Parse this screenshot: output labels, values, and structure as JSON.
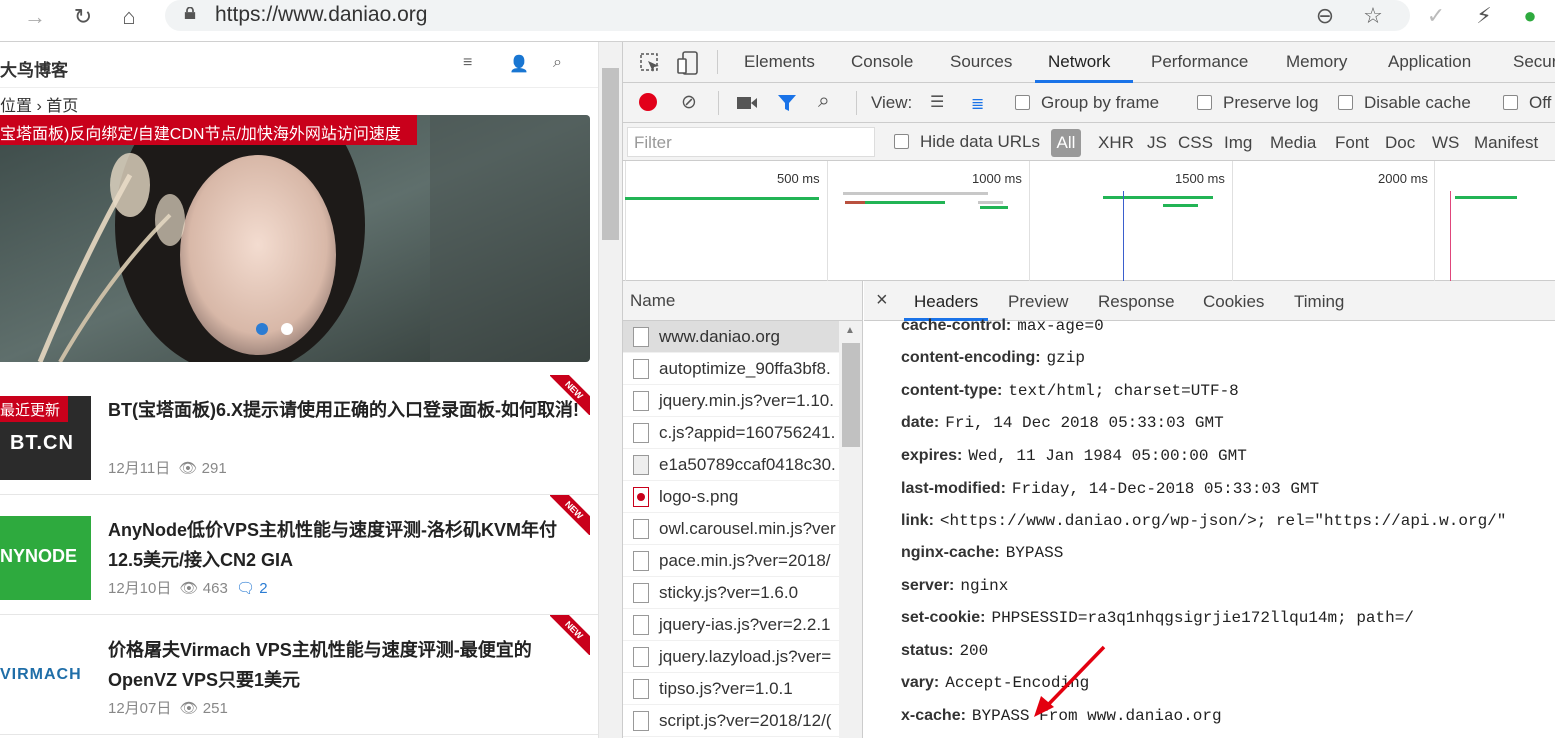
{
  "browser": {
    "url": "https://www.daniao.org"
  },
  "page": {
    "site_title": "大鸟博客",
    "breadcrumb": "位置 › 首页",
    "slider_caption": "宝塔面板)反向绑定/自建CDN节点/加快海外网站访问速度",
    "latest_badge": "最近更新",
    "new_ribbon": "NEW",
    "posts": [
      {
        "title": "BT(宝塔面板)6.X提示请使用正确的入口登录面板-如何取消!",
        "date": "12月11日",
        "views": "291",
        "comments": "",
        "thumb_label": "BT.CN",
        "thumb_color": "#2b2b2b"
      },
      {
        "title": "AnyNode低价VPS主机性能与速度评测-洛杉矶KVM年付12.5美元/接入CN2 GIA",
        "date": "12月10日",
        "views": "463",
        "comments": "2",
        "thumb_label": "NYNODE",
        "thumb_color": "#2eaa3e"
      },
      {
        "title": "价格屠夫Virmach VPS主机性能与速度评测-最便宜的OpenVZ VPS只要1美元",
        "date": "12月07日",
        "views": "251",
        "comments": "",
        "thumb_label": "VIRMACH",
        "thumb_color": "#ffffff"
      }
    ]
  },
  "devtools": {
    "tabs": [
      "Elements",
      "Console",
      "Sources",
      "Network",
      "Performance",
      "Memory",
      "Application",
      "Secur"
    ],
    "active_tab": "Network",
    "toolbar": {
      "view_label": "View:",
      "group_by_frame": "Group by frame",
      "preserve_log": "Preserve log",
      "disable_cache": "Disable cache",
      "offline": "Off"
    },
    "filter": {
      "placeholder": "Filter",
      "hide_data_urls": "Hide data URLs",
      "types": [
        "All",
        "XHR",
        "JS",
        "CSS",
        "Img",
        "Media",
        "Font",
        "Doc",
        "WS",
        "Manifest"
      ]
    },
    "timeline": {
      "ticks": [
        "500 ms",
        "1000 ms",
        "1500 ms",
        "2000 ms"
      ]
    },
    "requests": {
      "column": "Name",
      "items": [
        "www.daniao.org",
        "autoptimize_90ffa3bf8.",
        "jquery.min.js?ver=1.10.",
        "c.js?appid=160756241.",
        "e1a50789ccaf0418c30.",
        "logo-s.png",
        "owl.carousel.min.js?ver",
        "pace.min.js?ver=2018/",
        "sticky.js?ver=1.6.0",
        "jquery-ias.js?ver=2.2.1",
        "jquery.lazyload.js?ver=",
        "tipso.js?ver=1.0.1",
        "script.js?ver=2018/12/("
      ]
    },
    "detail": {
      "close": "×",
      "tabs": [
        "Headers",
        "Preview",
        "Response",
        "Cookies",
        "Timing"
      ],
      "headers": [
        {
          "key": "cache-control:",
          "value": "max-age=0"
        },
        {
          "key": "content-encoding:",
          "value": "gzip"
        },
        {
          "key": "content-type:",
          "value": "text/html; charset=UTF-8"
        },
        {
          "key": "date:",
          "value": "Fri, 14 Dec 2018 05:33:03 GMT"
        },
        {
          "key": "expires:",
          "value": "Wed, 11 Jan 1984 05:00:00 GMT"
        },
        {
          "key": "last-modified:",
          "value": "Friday, 14-Dec-2018 05:33:03 GMT"
        },
        {
          "key": "link:",
          "value": "<https://www.daniao.org/wp-json/>; rel=\"https://api.w.org/\""
        },
        {
          "key": "nginx-cache:",
          "value": "BYPASS"
        },
        {
          "key": "server:",
          "value": "nginx"
        },
        {
          "key": "set-cookie:",
          "value": "PHPSESSID=ra3q1nhqgsigrjie172llqu14m; path=/"
        },
        {
          "key": "status:",
          "value": "200"
        },
        {
          "key": "vary:",
          "value": "Accept-Encoding"
        },
        {
          "key": "x-cache:",
          "value": "BYPASS From www.daniao.org"
        }
      ]
    }
  },
  "colors": {
    "accent": "#1a73e8",
    "brand_red": "#c9001b",
    "record_red": "#e2001a",
    "bar_green": "#22b455"
  }
}
